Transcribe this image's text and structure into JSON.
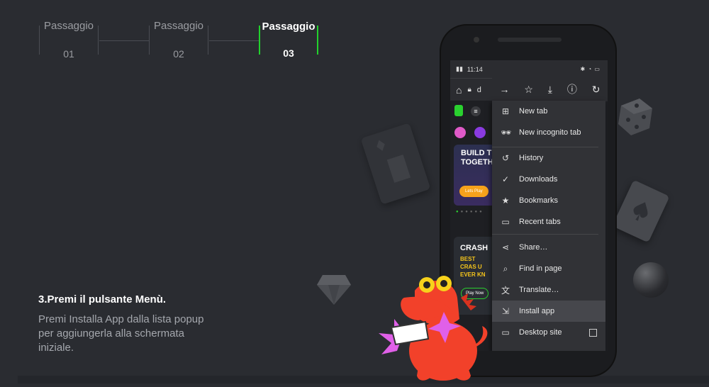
{
  "steps": [
    {
      "title": "Passaggio",
      "number": "01",
      "active": false
    },
    {
      "title": "Passaggio",
      "number": "02",
      "active": false
    },
    {
      "title": "Passaggio",
      "number": "03",
      "active": true
    }
  ],
  "instruction": {
    "heading": "3.Premi il pulsante Menù.",
    "text": "Premi Installa App dalla lista popup per aggiungerla alla schermata iniziale."
  },
  "phone": {
    "status_time": "11:14",
    "url_partial": "d",
    "toolbar_icons": [
      "forward-icon",
      "star-icon",
      "download-icon",
      "info-icon",
      "refresh-icon"
    ],
    "site": {
      "banner1": "BUILD TI TOGETH",
      "banner1_button": "Lets Play",
      "banner2": "CRASH",
      "banner2_sub": "BEST CRAS U EVER KN",
      "banner2_button": "Play Now"
    },
    "menu": [
      {
        "label": "New tab",
        "icon": "plus-box-icon"
      },
      {
        "label": "New incognito tab",
        "icon": "incognito-icon"
      },
      {
        "label": "History",
        "icon": "history-icon"
      },
      {
        "label": "Downloads",
        "icon": "downloads-icon"
      },
      {
        "label": "Bookmarks",
        "icon": "bookmark-star-icon"
      },
      {
        "label": "Recent tabs",
        "icon": "recent-tabs-icon"
      },
      {
        "label": "Share…",
        "icon": "share-icon"
      },
      {
        "label": "Find in page",
        "icon": "find-icon"
      },
      {
        "label": "Translate…",
        "icon": "translate-icon"
      },
      {
        "label": "Install app",
        "icon": "install-app-icon",
        "highlighted": true
      },
      {
        "label": "Desktop site",
        "icon": "desktop-icon"
      }
    ]
  },
  "colors": {
    "background": "#2a2c31",
    "active_step": "#22d12c",
    "menu_bg": "#313236",
    "highlight": "#46474c",
    "mascot": "#f2412a"
  }
}
